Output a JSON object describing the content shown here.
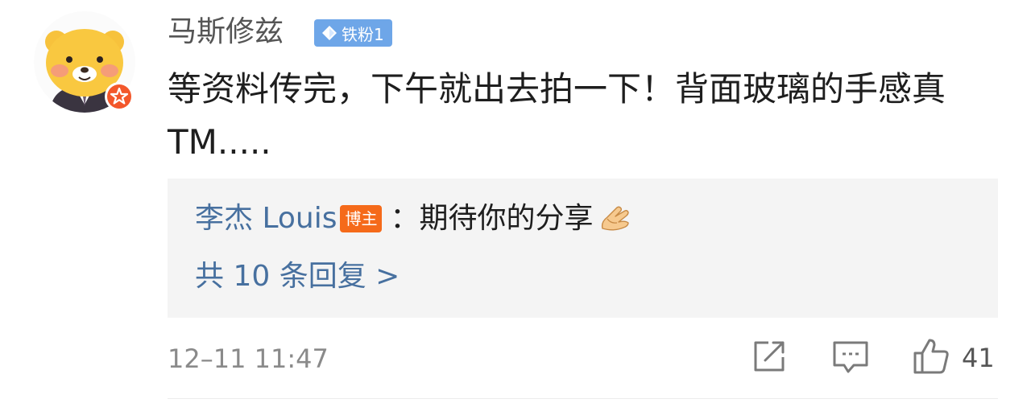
{
  "comment": {
    "username": "马斯修兹",
    "fan_badge": "铁粉1",
    "text": "等资料传完，下午就出去拍一下！背面玻璃的手感真 TM.....",
    "timestamp": "12–11 11:47"
  },
  "reply": {
    "author": "李杰 Louis",
    "author_badge": "博主",
    "text": "：期待你的分享",
    "more_replies": "共 10 条回复 >"
  },
  "actions": {
    "share_icon": "share-icon",
    "comment_icon": "comment-icon",
    "like_icon": "thumbs-up-icon",
    "like_count": "41"
  },
  "colors": {
    "link_blue": "#47709f",
    "badge_orange": "#f56a1a",
    "fan_badge_blue": "#6ea6e8",
    "reply_bg": "#f4f4f4"
  }
}
